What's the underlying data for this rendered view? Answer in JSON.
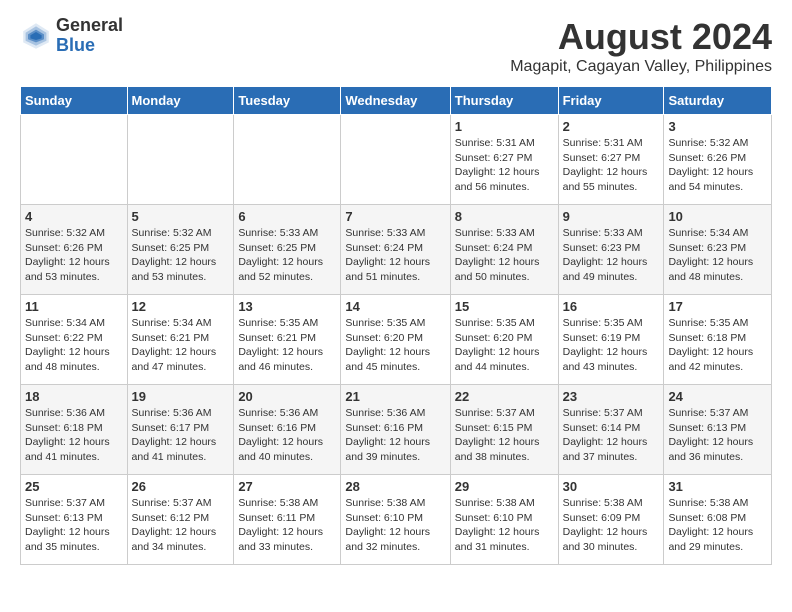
{
  "header": {
    "logo_general": "General",
    "logo_blue": "Blue",
    "title": "August 2024",
    "subtitle": "Magapit, Cagayan Valley, Philippines"
  },
  "days_of_week": [
    "Sunday",
    "Monday",
    "Tuesday",
    "Wednesday",
    "Thursday",
    "Friday",
    "Saturday"
  ],
  "weeks": [
    [
      {
        "day": "",
        "info": ""
      },
      {
        "day": "",
        "info": ""
      },
      {
        "day": "",
        "info": ""
      },
      {
        "day": "",
        "info": ""
      },
      {
        "day": "1",
        "info": "Sunrise: 5:31 AM\nSunset: 6:27 PM\nDaylight: 12 hours\nand 56 minutes."
      },
      {
        "day": "2",
        "info": "Sunrise: 5:31 AM\nSunset: 6:27 PM\nDaylight: 12 hours\nand 55 minutes."
      },
      {
        "day": "3",
        "info": "Sunrise: 5:32 AM\nSunset: 6:26 PM\nDaylight: 12 hours\nand 54 minutes."
      }
    ],
    [
      {
        "day": "4",
        "info": "Sunrise: 5:32 AM\nSunset: 6:26 PM\nDaylight: 12 hours\nand 53 minutes."
      },
      {
        "day": "5",
        "info": "Sunrise: 5:32 AM\nSunset: 6:25 PM\nDaylight: 12 hours\nand 53 minutes."
      },
      {
        "day": "6",
        "info": "Sunrise: 5:33 AM\nSunset: 6:25 PM\nDaylight: 12 hours\nand 52 minutes."
      },
      {
        "day": "7",
        "info": "Sunrise: 5:33 AM\nSunset: 6:24 PM\nDaylight: 12 hours\nand 51 minutes."
      },
      {
        "day": "8",
        "info": "Sunrise: 5:33 AM\nSunset: 6:24 PM\nDaylight: 12 hours\nand 50 minutes."
      },
      {
        "day": "9",
        "info": "Sunrise: 5:33 AM\nSunset: 6:23 PM\nDaylight: 12 hours\nand 49 minutes."
      },
      {
        "day": "10",
        "info": "Sunrise: 5:34 AM\nSunset: 6:23 PM\nDaylight: 12 hours\nand 48 minutes."
      }
    ],
    [
      {
        "day": "11",
        "info": "Sunrise: 5:34 AM\nSunset: 6:22 PM\nDaylight: 12 hours\nand 48 minutes."
      },
      {
        "day": "12",
        "info": "Sunrise: 5:34 AM\nSunset: 6:21 PM\nDaylight: 12 hours\nand 47 minutes."
      },
      {
        "day": "13",
        "info": "Sunrise: 5:35 AM\nSunset: 6:21 PM\nDaylight: 12 hours\nand 46 minutes."
      },
      {
        "day": "14",
        "info": "Sunrise: 5:35 AM\nSunset: 6:20 PM\nDaylight: 12 hours\nand 45 minutes."
      },
      {
        "day": "15",
        "info": "Sunrise: 5:35 AM\nSunset: 6:20 PM\nDaylight: 12 hours\nand 44 minutes."
      },
      {
        "day": "16",
        "info": "Sunrise: 5:35 AM\nSunset: 6:19 PM\nDaylight: 12 hours\nand 43 minutes."
      },
      {
        "day": "17",
        "info": "Sunrise: 5:35 AM\nSunset: 6:18 PM\nDaylight: 12 hours\nand 42 minutes."
      }
    ],
    [
      {
        "day": "18",
        "info": "Sunrise: 5:36 AM\nSunset: 6:18 PM\nDaylight: 12 hours\nand 41 minutes."
      },
      {
        "day": "19",
        "info": "Sunrise: 5:36 AM\nSunset: 6:17 PM\nDaylight: 12 hours\nand 41 minutes."
      },
      {
        "day": "20",
        "info": "Sunrise: 5:36 AM\nSunset: 6:16 PM\nDaylight: 12 hours\nand 40 minutes."
      },
      {
        "day": "21",
        "info": "Sunrise: 5:36 AM\nSunset: 6:16 PM\nDaylight: 12 hours\nand 39 minutes."
      },
      {
        "day": "22",
        "info": "Sunrise: 5:37 AM\nSunset: 6:15 PM\nDaylight: 12 hours\nand 38 minutes."
      },
      {
        "day": "23",
        "info": "Sunrise: 5:37 AM\nSunset: 6:14 PM\nDaylight: 12 hours\nand 37 minutes."
      },
      {
        "day": "24",
        "info": "Sunrise: 5:37 AM\nSunset: 6:13 PM\nDaylight: 12 hours\nand 36 minutes."
      }
    ],
    [
      {
        "day": "25",
        "info": "Sunrise: 5:37 AM\nSunset: 6:13 PM\nDaylight: 12 hours\nand 35 minutes."
      },
      {
        "day": "26",
        "info": "Sunrise: 5:37 AM\nSunset: 6:12 PM\nDaylight: 12 hours\nand 34 minutes."
      },
      {
        "day": "27",
        "info": "Sunrise: 5:38 AM\nSunset: 6:11 PM\nDaylight: 12 hours\nand 33 minutes."
      },
      {
        "day": "28",
        "info": "Sunrise: 5:38 AM\nSunset: 6:10 PM\nDaylight: 12 hours\nand 32 minutes."
      },
      {
        "day": "29",
        "info": "Sunrise: 5:38 AM\nSunset: 6:10 PM\nDaylight: 12 hours\nand 31 minutes."
      },
      {
        "day": "30",
        "info": "Sunrise: 5:38 AM\nSunset: 6:09 PM\nDaylight: 12 hours\nand 30 minutes."
      },
      {
        "day": "31",
        "info": "Sunrise: 5:38 AM\nSunset: 6:08 PM\nDaylight: 12 hours\nand 29 minutes."
      }
    ]
  ]
}
